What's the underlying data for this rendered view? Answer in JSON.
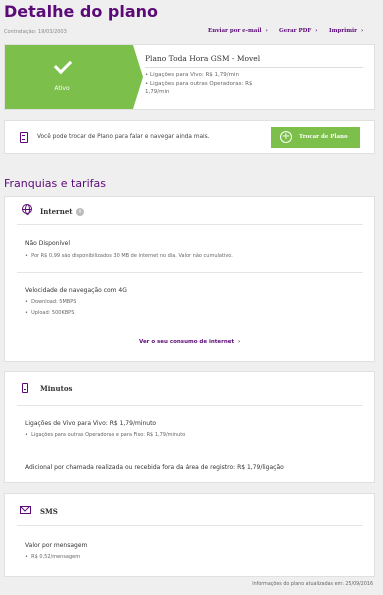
{
  "header": {
    "title": "Detalhe do plano",
    "contract_date": "Contratação: 19/03/2003",
    "links": [
      {
        "label": "Enviar por e-mail",
        "icon": "chevron-right-icon"
      },
      {
        "label": "Gerar PDF",
        "icon": "chevron-right-icon"
      },
      {
        "label": "Imprimir",
        "icon": "chevron-right-icon"
      }
    ]
  },
  "plan": {
    "status": "Ativo",
    "name": "Plano Toda Hora GSM - Movel",
    "details": [
      "Ligações para Vivo: R$ 1,79/min",
      "Ligações para outras Operadoras: R$ 1,79/min"
    ]
  },
  "change_plan": {
    "text": "Você pode trocar de Plano para falar e navegar ainda mais.",
    "button": "Trocar de Plano"
  },
  "section_title": "Franquias e tarifas",
  "internet": {
    "title": "Internet",
    "status": "Não Disponível",
    "note": "Por R$ 0,99 são disponibilizados 30 MB de internet no dia. Valor não cumulativo.",
    "speed_title": "Velocidade de navegação com 4G",
    "download": "Download: 5MBPS",
    "upload": "Upload: 500KBPS",
    "link": "Ver o seu consumo de internet"
  },
  "minutos": {
    "title": "Minutos",
    "line1": "Ligações de Vivo para Vivo: R$ 1,79/minuto",
    "line1_sub": "Ligações para outras Operadoras e para Fixo: R$ 1,79/minuto",
    "line2": "Adicional por chamada realizada ou recebida fora da área de registro: R$ 1,79/ligação"
  },
  "sms": {
    "title": "SMS",
    "label": "Valor por mensagem",
    "value": "R$ 0,52/mensagem"
  },
  "footer": "Informações do plano atualizadas em: 25/09/2016",
  "colors": {
    "brand": "#5b0a78",
    "accent": "#7cc04b",
    "background": "#efefef"
  }
}
